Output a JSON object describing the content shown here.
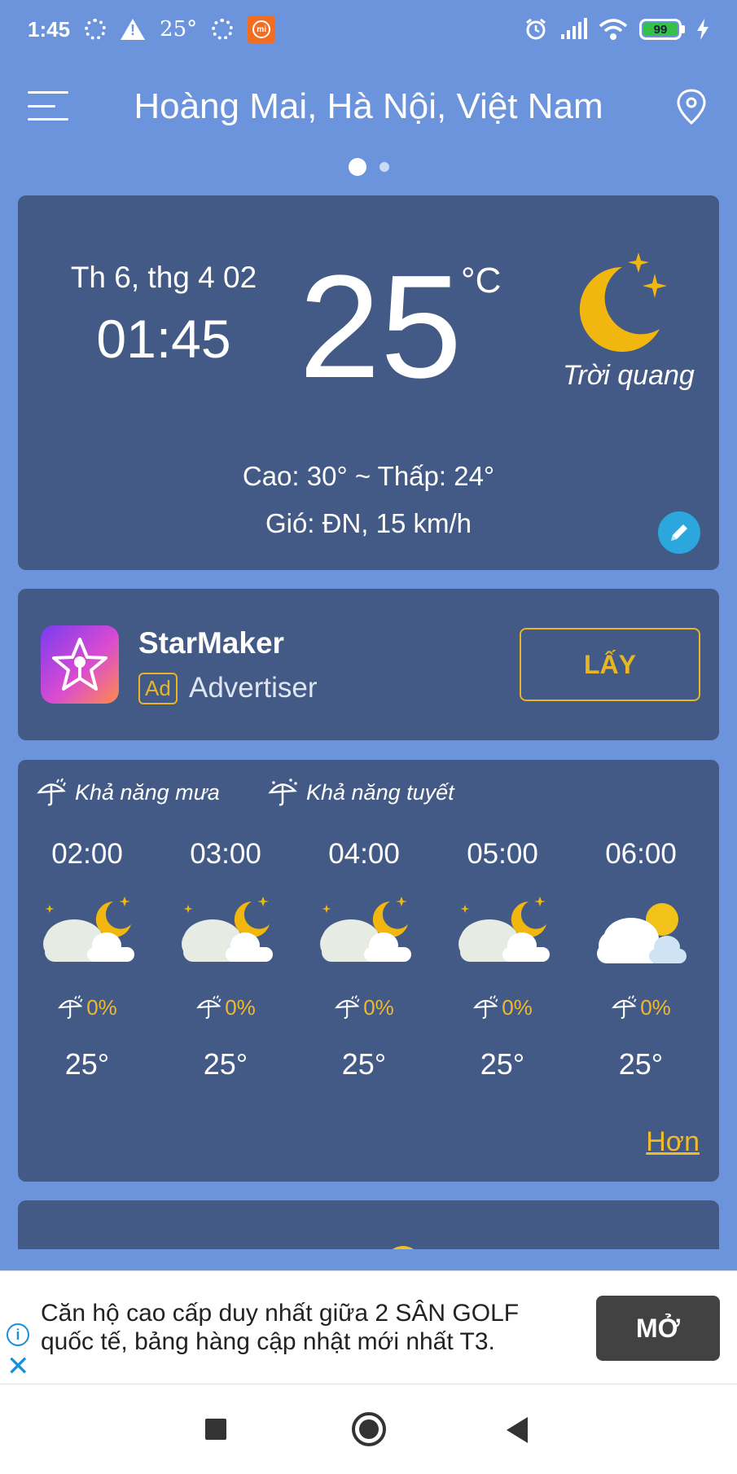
{
  "status_bar": {
    "time": "1:45",
    "temp": "25°",
    "battery": "99",
    "icons": [
      "loader-icon",
      "warning-icon",
      "loader-icon",
      "mi-app-icon",
      "alarm-icon",
      "signal-icon",
      "wifi-icon",
      "battery-icon",
      "charging-icon"
    ]
  },
  "header": {
    "location": "Hoàng Mai, Hà Nội, Việt Nam"
  },
  "current": {
    "date": "Th 6, thg 4 02",
    "time": "01:45",
    "temperature": "25",
    "unit": "°C",
    "condition": "Trời quang",
    "hi_lo": "Cao: 30° ~ Thấp: 24°",
    "wind": "Gió: ĐN, 15 km/h"
  },
  "ad": {
    "name": "StarMaker",
    "badge": "Ad",
    "advertiser": "Advertiser",
    "cta": "LẤY"
  },
  "hourly": {
    "rain_label": "Khả năng mưa",
    "snow_label": "Khả năng tuyết",
    "more": "Hơn",
    "items": [
      {
        "time": "02:00",
        "precip": "0%",
        "temp": "25°",
        "icon": "night-partly-cloudy"
      },
      {
        "time": "03:00",
        "precip": "0%",
        "temp": "25°",
        "icon": "night-partly-cloudy"
      },
      {
        "time": "04:00",
        "precip": "0%",
        "temp": "25°",
        "icon": "night-partly-cloudy"
      },
      {
        "time": "05:00",
        "precip": "0%",
        "temp": "25°",
        "icon": "night-partly-cloudy"
      },
      {
        "time": "06:00",
        "precip": "0%",
        "temp": "25°",
        "icon": "day-partly-cloudy"
      }
    ]
  },
  "banner": {
    "text": "Căn hộ cao cấp duy nhất giữa 2 SÂN GOLF quốc tế, bảng hàng cập nhật mới nhất T3.",
    "cta": "MỞ"
  },
  "colors": {
    "background": "#6b94dc",
    "card": "#425a85",
    "accent": "#f2b92b",
    "moon": "#f2b70f"
  }
}
